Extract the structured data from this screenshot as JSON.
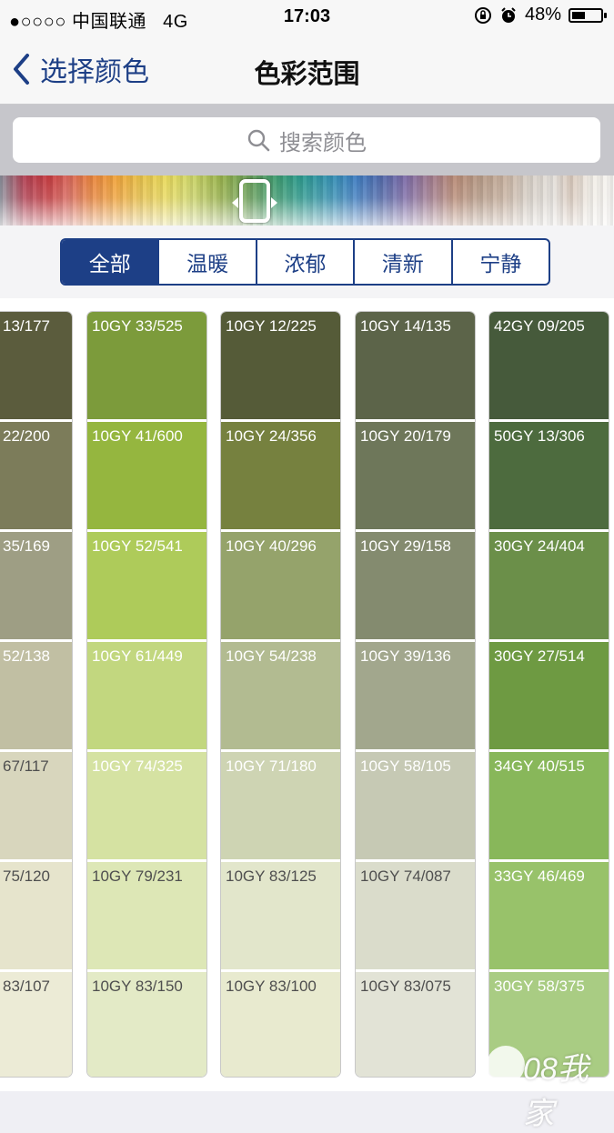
{
  "status": {
    "carrier": "●○○○○ 中国联通",
    "network": "4G",
    "time": "17:03",
    "battery": "48%",
    "battery_level": 0.48
  },
  "nav": {
    "back_label": "选择颜色",
    "title": "色彩范围"
  },
  "search": {
    "placeholder": "搜索颜色"
  },
  "segments": [
    "全部",
    "温暖",
    "浓郁",
    "清新",
    "宁静"
  ],
  "active_segment": 0,
  "columns": [
    [
      "13/177",
      "22/200",
      "35/169",
      "52/138",
      "67/117",
      "75/120",
      "83/107"
    ],
    [
      "10GY 33/525",
      "10GY 41/600",
      "10GY 52/541",
      "10GY 61/449",
      "10GY 74/325",
      "10GY 79/231",
      "10GY 83/150"
    ],
    [
      "10GY 12/225",
      "10GY 24/356",
      "10GY 40/296",
      "10GY 54/238",
      "10GY 71/180",
      "10GY 83/125",
      "10GY 83/100"
    ],
    [
      "10GY 14/135",
      "10GY 20/179",
      "10GY 29/158",
      "10GY 39/136",
      "10GY 58/105",
      "10GY 74/087",
      "10GY 83/075"
    ],
    [
      "42GY 09/205",
      "50GY 13/306",
      "30GY 24/404",
      "30GY 27/514",
      "34GY 40/515",
      "33GY 46/469",
      "30GY 58/375"
    ]
  ],
  "column_colors": [
    [
      "#5b5c3d",
      "#7c7c5a",
      "#9e9e84",
      "#c1bfa3",
      "#d8d6bd",
      "#e6e4cc",
      "#ecebd6"
    ],
    [
      "#7c9b3b",
      "#95b63f",
      "#aecb5a",
      "#c2d77f",
      "#d5e2a2",
      "#dde7b6",
      "#e3eac6"
    ],
    [
      "#555b38",
      "#76813f",
      "#95a36b",
      "#b2bb91",
      "#ced4b3",
      "#e2e6cb",
      "#e8eacf"
    ],
    [
      "#5c6449",
      "#6e775a",
      "#848b6f",
      "#a2a78d",
      "#c6c9b4",
      "#dadccb",
      "#e2e3d6"
    ],
    [
      "#465a3b",
      "#4d6b3e",
      "#6b8f49",
      "#6e9a42",
      "#88b75a",
      "#98c26a",
      "#a9cc83"
    ]
  ],
  "dark_text_from_row": [
    4,
    5,
    5,
    5,
    7
  ],
  "watermark": "08我家"
}
